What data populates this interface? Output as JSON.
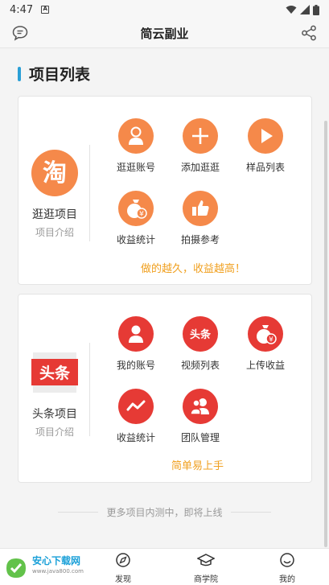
{
  "status": {
    "time": "4:47",
    "sim": "A"
  },
  "appbar": {
    "title": "简云副业"
  },
  "section": {
    "title": "项目列表"
  },
  "card1": {
    "brand_glyph": "淘",
    "brand_name": "逛逛项目",
    "brand_sub": "项目介绍",
    "items": [
      {
        "label": "逛逛账号",
        "icon": "user-icon"
      },
      {
        "label": "添加逛逛",
        "icon": "plus-icon"
      },
      {
        "label": "样品列表",
        "icon": "play-icon"
      },
      {
        "label": "收益统计",
        "icon": "money-bag-icon"
      },
      {
        "label": "拍摄参考",
        "icon": "thumbs-up-icon"
      }
    ],
    "slogan": "做的越久，收益越高！"
  },
  "card2": {
    "brand_glyph": "头条",
    "brand_name": "头条项目",
    "brand_sub": "项目介绍",
    "items": [
      {
        "label": "我的账号",
        "icon": "user-icon"
      },
      {
        "label": "视频列表",
        "icon": "toutiao-icon",
        "glyph": "头条"
      },
      {
        "label": "上传收益",
        "icon": "money-bag-icon"
      },
      {
        "label": "收益统计",
        "icon": "trend-icon"
      },
      {
        "label": "团队管理",
        "icon": "team-icon"
      }
    ],
    "slogan": "简单易上手"
  },
  "more_text": "更多项目内测中，即将上线",
  "tabs": [
    {
      "label": "发现",
      "icon": "compass-icon"
    },
    {
      "label": "商学院",
      "icon": "graduation-cap-icon"
    },
    {
      "label": "我的",
      "icon": "smile-icon"
    }
  ],
  "watermark": {
    "title": "安心下载网",
    "sub": "www.java800.com"
  },
  "colors": {
    "accent_blue": "#2a9fd6",
    "orange": "#f5894a",
    "red": "#e63a35",
    "slogan": "#f0a020"
  }
}
